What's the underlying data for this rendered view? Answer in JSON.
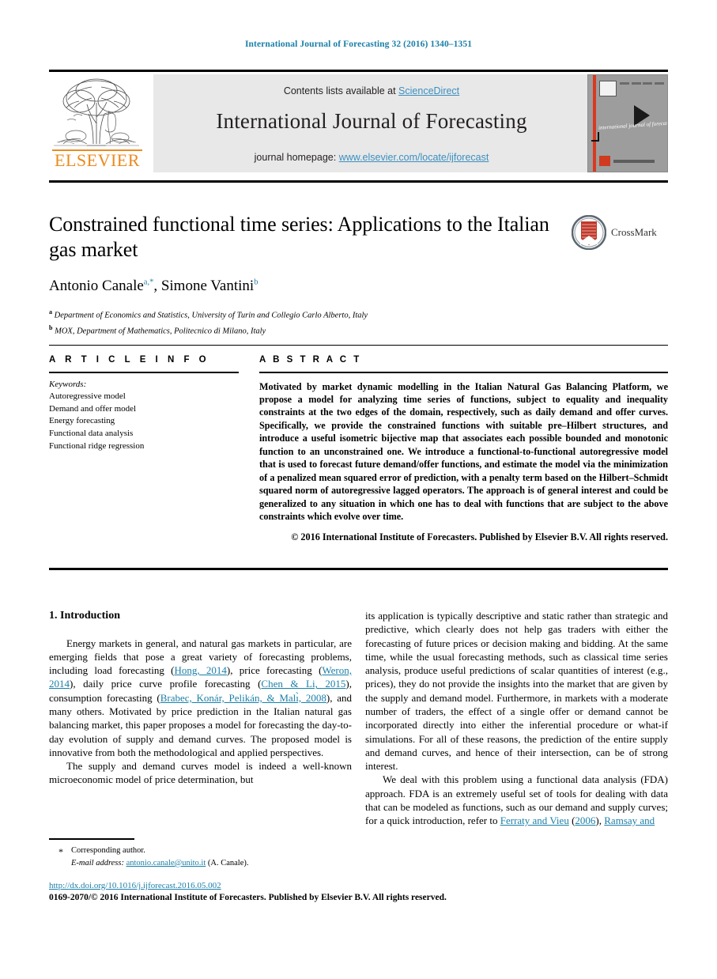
{
  "running_head": "International Journal of Forecasting 32 (2016) 1340–1351",
  "masthead": {
    "contents_prefix": "Contents lists available at ",
    "sciencedirect": "ScienceDirect",
    "journal_title": "International Journal of Forecasting",
    "homepage_prefix": "journal homepage: ",
    "homepage_url": "www.elsevier.com/locate/ijforecast",
    "publisher_wordmark": "ELSEVIER",
    "cover_script": "international journal of forecasting"
  },
  "article": {
    "title": "Constrained functional time series: Applications to the Italian gas market",
    "authors_html": "Antonio Canale<sup>a,*</sup>, Simone Vantini<sup>b</sup>",
    "authors_plain": "Antonio Canale a,*, Simone Vantini b",
    "affiliation_a_marker": "a",
    "affiliation_a": "Department of Economics and Statistics, University of Turin and Collegio Carlo Alberto, Italy",
    "affiliation_b_marker": "b",
    "affiliation_b": "MOX, Department of Mathematics, Politecnico di Milano, Italy",
    "crossmark_label": "CrossMark"
  },
  "info": {
    "heading": "A R T I C L E   I N F O",
    "keywords_heading": "Keywords:",
    "keywords": [
      "Autoregressive model",
      "Demand and offer model",
      "Energy forecasting",
      "Functional data analysis",
      "Functional ridge regression"
    ]
  },
  "abstract": {
    "heading": "A B S T R A C T",
    "body": "Motivated by market dynamic modelling in the Italian Natural Gas Balancing Platform, we propose a model for analyzing time series of functions, subject to equality and inequality constraints at the two edges of the domain, respectively, such as daily demand and offer curves. Specifically, we provide the constrained functions with suitable pre–Hilbert structures, and introduce a useful isometric bijective map that associates each possible bounded and monotonic function to an unconstrained one. We introduce a functional-to-functional autoregressive model that is used to forecast future demand/offer functions, and estimate the model via the minimization of a penalized mean squared error of prediction, with a penalty term based on the Hilbert–Schmidt squared norm of autoregressive lagged operators. The approach is of general interest and could be generalized to any situation in which one has to deal with functions that are subject to the above constraints which evolve over time.",
    "copyright": "© 2016 International Institute of Forecasters. Published by Elsevier B.V. All rights reserved."
  },
  "body": {
    "section_heading": "1. Introduction",
    "left_para_1_parts": [
      {
        "t": "Energy markets in general, and natural gas markets in particular, are emerging fields that pose a great variety of forecasting problems, including load forecasting (",
        "link": false
      },
      {
        "t": "Hong, 2014",
        "link": true
      },
      {
        "t": "), price forecasting (",
        "link": false
      },
      {
        "t": "Weron, 2014",
        "link": true
      },
      {
        "t": "), daily price curve profile forecasting (",
        "link": false
      },
      {
        "t": "Chen & Li, 2015",
        "link": true
      },
      {
        "t": "), consumption forecasting (",
        "link": false
      },
      {
        "t": "Brabec, Konár, Pelikán, & Malı̀, 2008",
        "link": true
      },
      {
        "t": "), and many others. Motivated by price prediction in the Italian natural gas balancing market, this paper proposes a model for forecasting the day-to-day evolution of supply and demand curves. The proposed model is innovative from both the methodological and applied perspectives.",
        "link": false
      }
    ],
    "left_para_2": "The supply and demand curves model is indeed a well-known microeconomic model of price determination, but",
    "right_para_1": "its application is typically descriptive and static rather than strategic and predictive, which clearly does not help gas traders with either the forecasting of future prices or decision making and bidding. At the same time, while the usual forecasting methods, such as classical time series analysis, produce useful predictions of scalar quantities of interest (e.g., prices), they do not provide the insights into the market that are given by the supply and demand model. Furthermore, in markets with a moderate number of traders, the effect of a single offer or demand cannot be incorporated directly into either the inferential procedure or what-if simulations. For all of these reasons, the prediction of the entire supply and demand curves, and hence of their intersection, can be of strong interest.",
    "right_para_2_parts": [
      {
        "t": "We deal with this problem using a functional data analysis (FDA) approach. FDA is an extremely useful set of tools for dealing with data that can be modeled as functions, such as our demand and supply curves; for a quick introduction, refer to ",
        "link": false
      },
      {
        "t": "Ferraty and Vieu",
        "link": true
      },
      {
        "t": " (",
        "link": false
      },
      {
        "t": "2006",
        "link": true
      },
      {
        "t": "), ",
        "link": false
      },
      {
        "t": "Ramsay and",
        "link": true
      }
    ]
  },
  "footnote": {
    "star": "*",
    "corresponding": "Corresponding author.",
    "email_label": "E-mail address:",
    "email": "antonio.canale@unito.it",
    "email_owner": "(A. Canale)."
  },
  "bottom": {
    "doi": "http://dx.doi.org/10.1016/j.ijforecast.2016.05.002",
    "issn_line": "0169-2070/© 2016 International Institute of Forecasters. Published by Elsevier B.V. All rights reserved."
  },
  "colors": {
    "link_blue": "#1a7fa8",
    "sciencedirect_blue": "#3c8fbf",
    "elsevier_orange": "#ea8b1f",
    "crossmark_red": "#c0392b",
    "masthead_grey": "#e8e8e8"
  }
}
